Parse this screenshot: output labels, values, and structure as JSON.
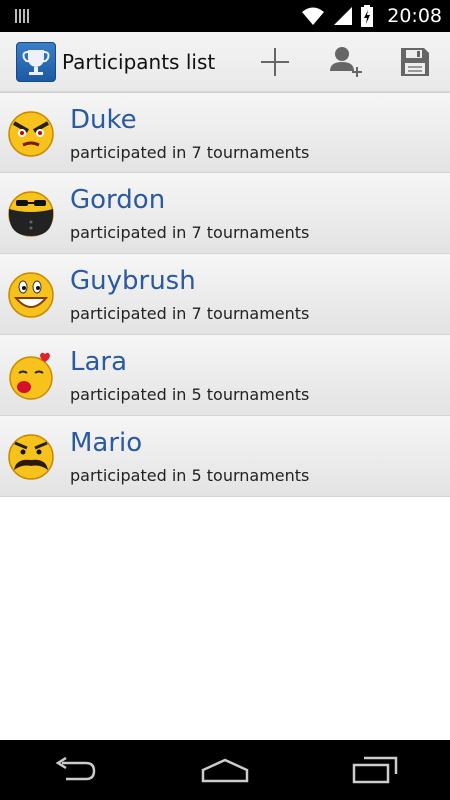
{
  "status_bar": {
    "time": "20:08"
  },
  "action_bar": {
    "title": "Participants list"
  },
  "participants": [
    {
      "name": "Duke",
      "info": "participated in 7 tournaments"
    },
    {
      "name": "Gordon",
      "info": "participated in 7 tournaments"
    },
    {
      "name": "Guybrush",
      "info": "participated in 7 tournaments"
    },
    {
      "name": "Lara",
      "info": "participated in 5 tournaments"
    },
    {
      "name": "Mario",
      "info": "participated in 5 tournaments"
    }
  ],
  "colors": {
    "accent": "#2a5aa0",
    "status_bar": "#000000",
    "nav_bar": "#000000"
  },
  "icons": [
    "trophy-icon",
    "plus-icon",
    "add-user-icon",
    "save-icon",
    "back-icon",
    "home-icon",
    "recents-icon"
  ]
}
